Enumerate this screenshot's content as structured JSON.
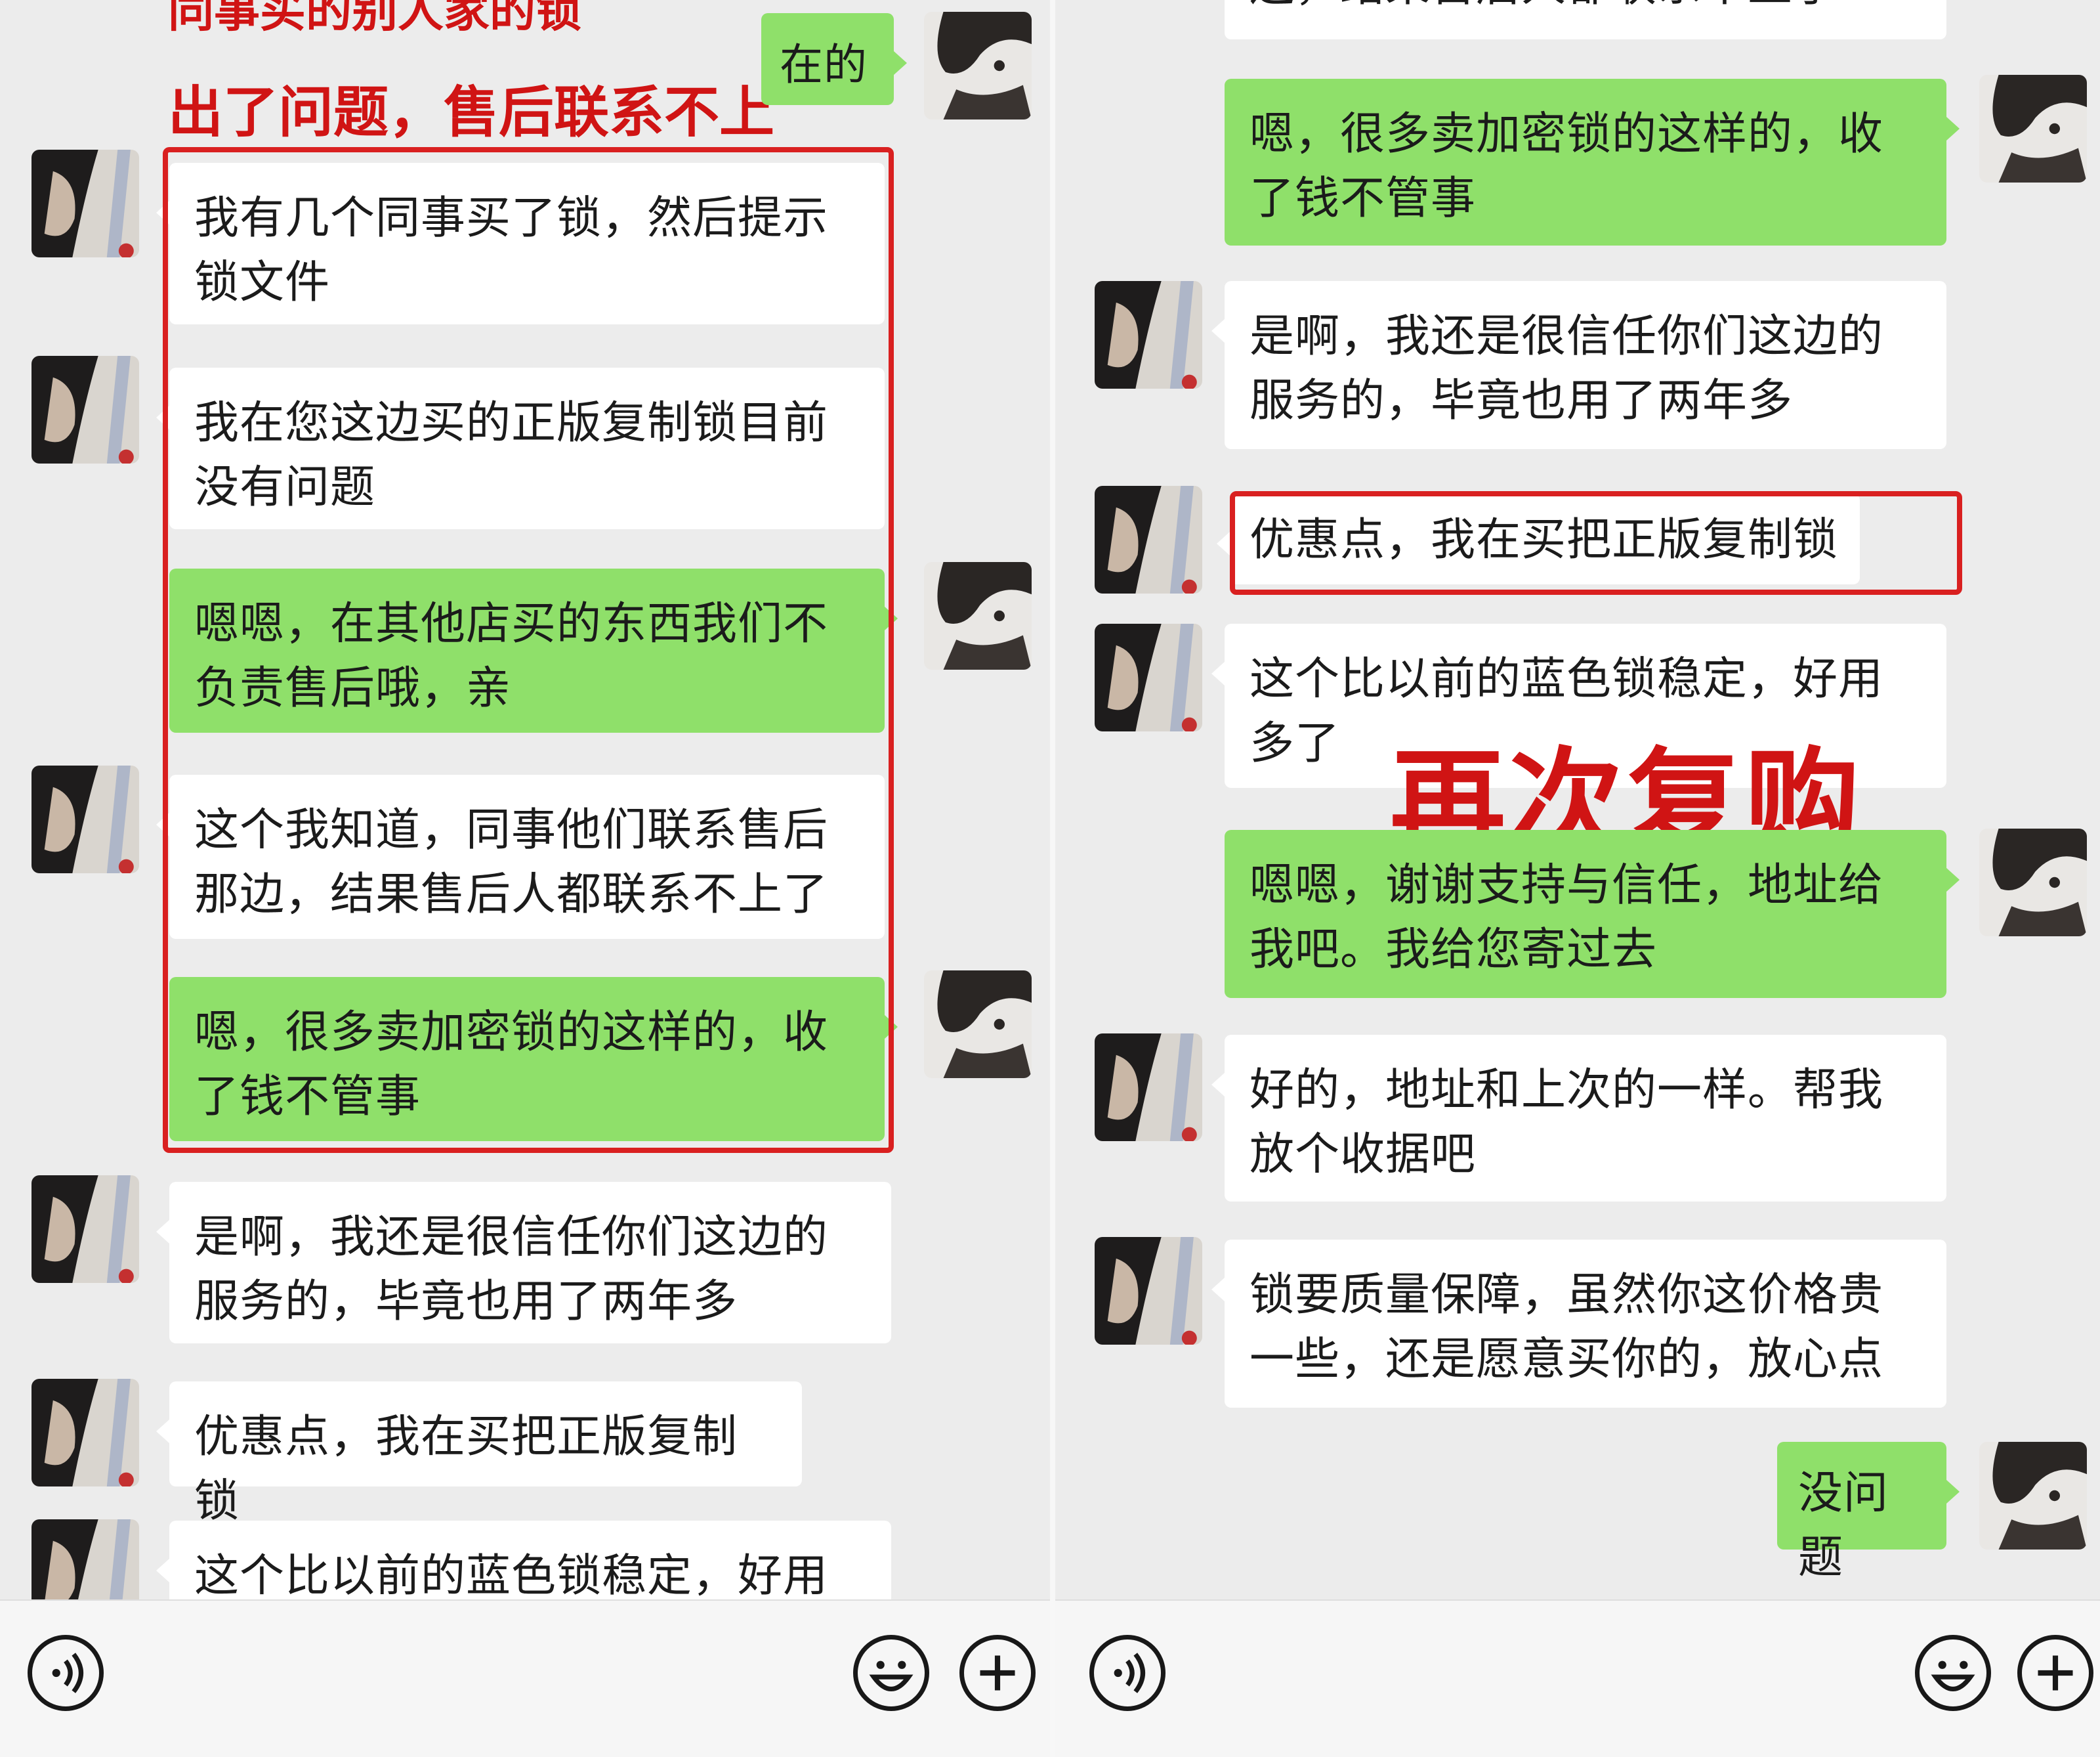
{
  "left": {
    "overlay_top": "同事买的别人家的锁",
    "overlay_bottom": "出了问题，售后联系不上",
    "m1": "在的",
    "m2": "我有几个同事买了锁，然后提示锁文件",
    "m3": "我在您这边买的正版复制锁目前没有问题",
    "m4": "嗯嗯，在其他店买的东西我们不负责售后哦，亲",
    "m5": "这个我知道，同事他们联系售后那边，结果售后人都联系不上了",
    "m6": "嗯，很多卖加密锁的这样的，收了钱不管事",
    "m7": "是啊，我还是很信任你们这边的服务的，毕竟也用了两年多",
    "m8": "优惠点，我在买把正版复制锁",
    "m9": "这个比以前的蓝色锁稳定，好用多"
  },
  "right": {
    "m0": "边，结果售后人都联系不上了",
    "m1": "嗯，很多卖加密锁的这样的，收了钱不管事",
    "m2": "是啊，我还是很信任你们这边的服务的，毕竟也用了两年多",
    "m3": "优惠点，我在买把正版复制锁",
    "m4": "这个比以前的蓝色锁稳定，好用多了",
    "overlay": "再次复购",
    "m5": "嗯嗯，谢谢支持与信任，地址给我吧。我给您寄过去",
    "m6": "好的，地址和上次的一样。帮我放个收据吧",
    "m7": "锁要质量保障，虽然你这价格贵一些，还是愿意买你的，放心点",
    "m8": "没问题"
  },
  "icons": [
    "voice-icon",
    "emoji-icon",
    "plus-icon"
  ],
  "colors": {
    "green_bubble": "#8fe06a",
    "white_bubble": "#ffffff",
    "background": "#ececec",
    "highlight_red": "#d92020"
  }
}
